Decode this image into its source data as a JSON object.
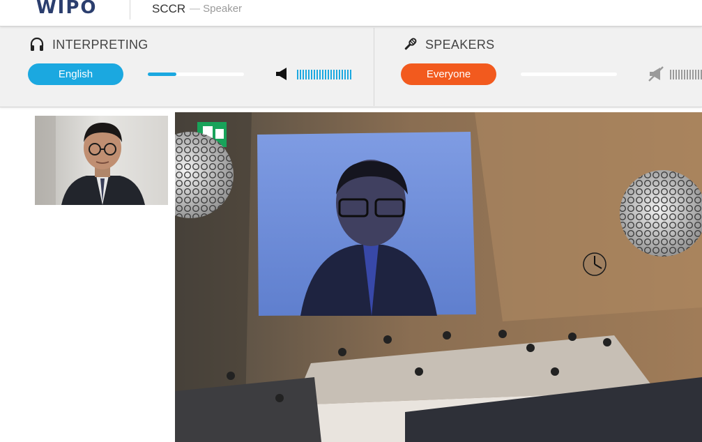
{
  "header": {
    "logo": "WIPO",
    "event": "SCCR",
    "separator": "—",
    "role": "Speaker"
  },
  "interpreting": {
    "title": "INTERPRETING",
    "icon": "headphones-icon",
    "language": "English",
    "slider_level": 0.3,
    "volume_icon": "speaker-volume-icon",
    "accent_color": "#1ba8e0"
  },
  "speakers": {
    "title": "SPEAKERS",
    "icon": "microphone-icon",
    "selection": "Everyone",
    "slider_level": 0,
    "volume_icon": "speaker-muted-icon",
    "accent_color": "#f25a1e"
  }
}
